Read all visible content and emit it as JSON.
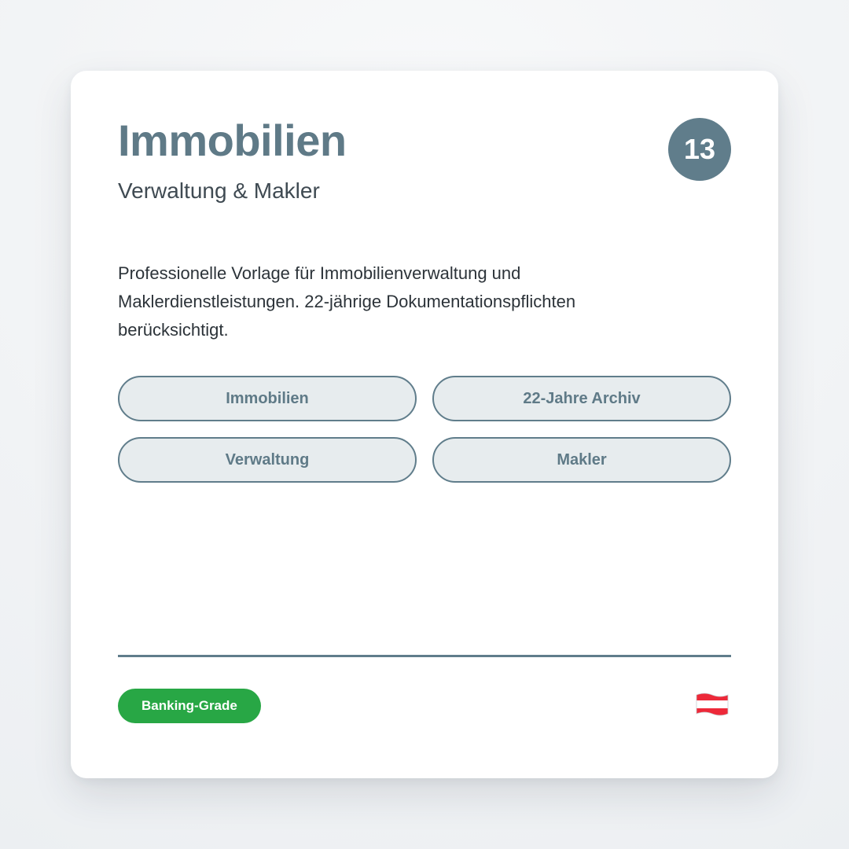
{
  "card": {
    "title": "Immobilien",
    "subtitle": "Verwaltung & Makler",
    "number": "13",
    "description": "Professionelle Vorlage für Immobilienverwaltung und Maklerdienstleistungen. 22-jährige Dokumentationspflichten berücksichtigt.",
    "tags": [
      {
        "label": "Immobilien"
      },
      {
        "label": "22-Jahre Archiv"
      },
      {
        "label": "Verwaltung"
      },
      {
        "label": "Makler"
      }
    ],
    "footer": {
      "badge": "Banking-Grade",
      "flag_icon": "austria-flag-icon"
    }
  },
  "colors": {
    "accent": "#607d8b",
    "tag_background": "#e7ecee",
    "badge_green": "#28a745",
    "flag_red": "#ed2939",
    "flag_white": "#ffffff"
  }
}
